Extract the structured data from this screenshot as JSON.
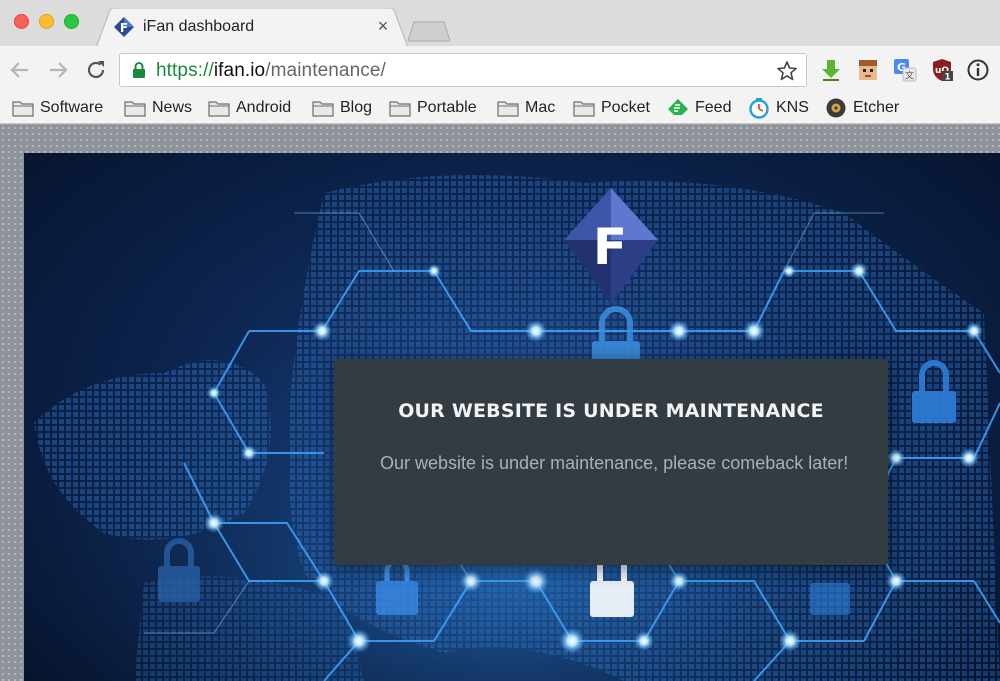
{
  "browser": {
    "tab": {
      "title": "iFan dashboard",
      "close_glyph": "×",
      "favicon": "ifan-logo-icon"
    },
    "url": {
      "scheme": "https://",
      "host": "ifan.io",
      "path": "/maintenance/"
    },
    "extensions": [
      "download-arrow-icon",
      "face-extension-icon",
      "google-translate-icon",
      "ublock-icon",
      "info-icon"
    ],
    "extension_badge": "1"
  },
  "bookmarks": [
    {
      "label": "Software",
      "icon": "folder-icon"
    },
    {
      "label": "News",
      "icon": "folder-icon"
    },
    {
      "label": "Android",
      "icon": "folder-icon"
    },
    {
      "label": "Blog",
      "icon": "folder-icon"
    },
    {
      "label": "Portable",
      "icon": "folder-icon"
    },
    {
      "label": "Mac",
      "icon": "folder-icon"
    },
    {
      "label": "Pocket",
      "icon": "folder-icon"
    },
    {
      "label": "Feed",
      "icon": "feedly-icon"
    },
    {
      "label": "KNS",
      "icon": "kns-icon"
    },
    {
      "label": "Etcher",
      "icon": "etcher-icon"
    }
  ],
  "page": {
    "logo_letter": "F",
    "heading": "OUR WEBSITE IS UNDER MAINTENANCE",
    "message": "Our website is under maintenance, please comeback later!"
  },
  "colors": {
    "secure_green": "#1a8a3a",
    "card_bg": "#343c43",
    "hero_blue": "#0d2550",
    "glow": "#5fc3ff"
  }
}
